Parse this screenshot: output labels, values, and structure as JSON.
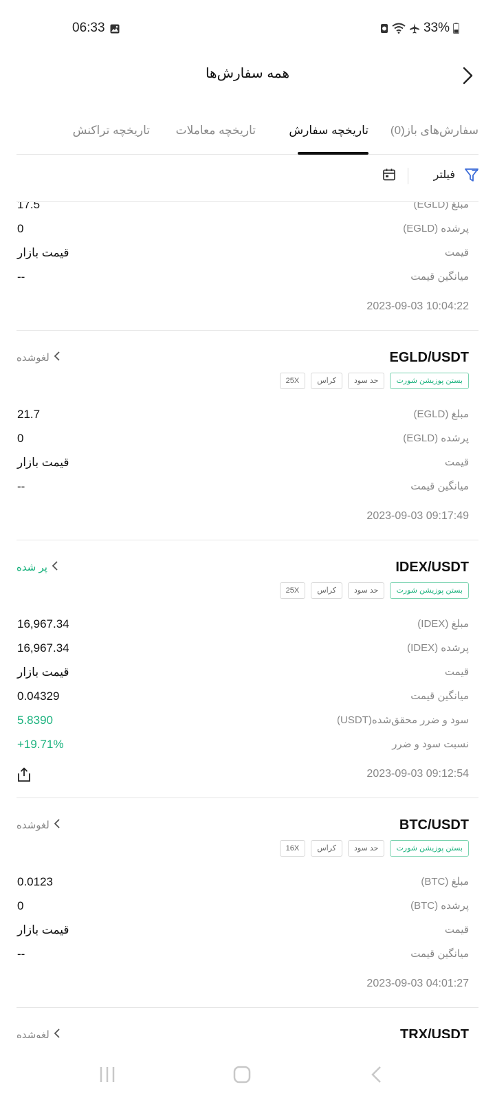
{
  "status_bar": {
    "time": "06:33",
    "battery": "33%"
  },
  "header": {
    "title": "همه سفارش‌ها"
  },
  "tabs": [
    {
      "label": "سفارش‌های باز(0)",
      "active": false
    },
    {
      "label": "تاریخچه سفارش",
      "active": true
    },
    {
      "label": "تاریخچه معاملات",
      "active": false
    },
    {
      "label": "تاریخچه تراکنش",
      "active": false
    }
  ],
  "filter": {
    "label": "فیلتر"
  },
  "partial_top": {
    "amount_label": "مبلغ (EGLD)",
    "amount": "17.5",
    "filled_label": "پرشده (EGLD)",
    "filled": "0",
    "price_label": "قیمت",
    "price": "قیمت بازار",
    "avg_label": "میانگین قیمت",
    "avg": "--",
    "date": "2023-09-03 10:04:22"
  },
  "orders": [
    {
      "pair": "EGLD/USDT",
      "status": "لغوشده",
      "tags": [
        "بستن پوزیشن شورت",
        "حد سود",
        "کراس",
        "25X"
      ],
      "amount_label": "مبلغ (EGLD)",
      "amount": "21.7",
      "filled_label": "پرشده (EGLD)",
      "filled": "0",
      "price_label": "قیمت",
      "price": "قیمت بازار",
      "avg_label": "میانگین قیمت",
      "avg": "--",
      "date": "2023-09-03 09:17:49"
    },
    {
      "pair": "IDEX/USDT",
      "status": "پر شده",
      "tags": [
        "بستن پوزیشن شورت",
        "حد سود",
        "کراس",
        "25X"
      ],
      "amount_label": "مبلغ (IDEX)",
      "amount": "16,967.34",
      "filled_label": "پرشده (IDEX)",
      "filled": "16,967.34",
      "price_label": "قیمت",
      "price": "قیمت بازار",
      "avg_label": "میانگین قیمت",
      "avg": "0.04329",
      "pnl_label": "سود و ضرر محقق‌شده(USDT)",
      "pnl": "5.8390",
      "pnl_ratio_label": "نسبت سود و ضرر",
      "pnl_ratio": "+19.71%",
      "date": "2023-09-03 09:12:54"
    },
    {
      "pair": "BTC/USDT",
      "status": "لغوشده",
      "tags": [
        "بستن پوزیشن شورت",
        "حد سود",
        "کراس",
        "16X"
      ],
      "amount_label": "مبلغ (BTC)",
      "amount": "0.0123",
      "filled_label": "پرشده (BTC)",
      "filled": "0",
      "price_label": "قیمت",
      "price": "قیمت بازار",
      "avg_label": "میانگین قیمت",
      "avg": "--",
      "date": "2023-09-03 04:01:27"
    },
    {
      "pair": "TRX/USDT",
      "status": "لغوشده"
    }
  ],
  "colors": {
    "accent_green": "#1bb27e",
    "text_muted": "#888888",
    "divider": "#e6e6e6"
  },
  "icons": {
    "back": "chevron-right-icon",
    "filter": "funnel-icon",
    "calendar": "calendar-icon",
    "share": "share-icon",
    "status_chevron": "chevron-left-icon"
  }
}
